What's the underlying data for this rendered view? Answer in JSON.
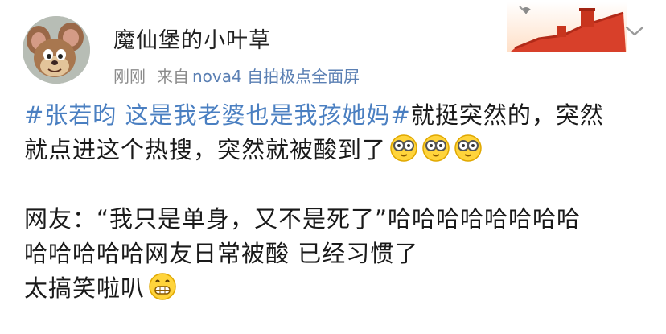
{
  "post": {
    "author": {
      "name": "魔仙堡的小叶草",
      "avatar_icon": "cartoon-mouse-avatar-icon"
    },
    "meta": {
      "time": "刚刚",
      "from_label": "来自",
      "device": "nova4 自拍极点全面屏"
    },
    "decoration_icon": "great-wall-dove-icon",
    "menu_icon": "chevron-down-icon",
    "body": {
      "line1_hashtag": "#张若昀 这是我老婆也是我孩她妈#",
      "line1_text": "就挺突然的，突然",
      "line2_text": "就点进这个热搜，突然就被酸到了",
      "line2_emoji": "glasses-face-emoji",
      "line3_text": "网友：“我只是单身，又不是死了”哈哈哈哈哈哈哈哈",
      "line4_text": "哈哈哈哈哈网友日常被酸  已经习惯了",
      "line5_text": "太搞笑啦叭",
      "line5_emoji": "grinning-face-emoji"
    },
    "colors": {
      "hashtag": "#4a7fc1",
      "source": "#5a7fb3",
      "meta": "#8c8c8c"
    }
  }
}
